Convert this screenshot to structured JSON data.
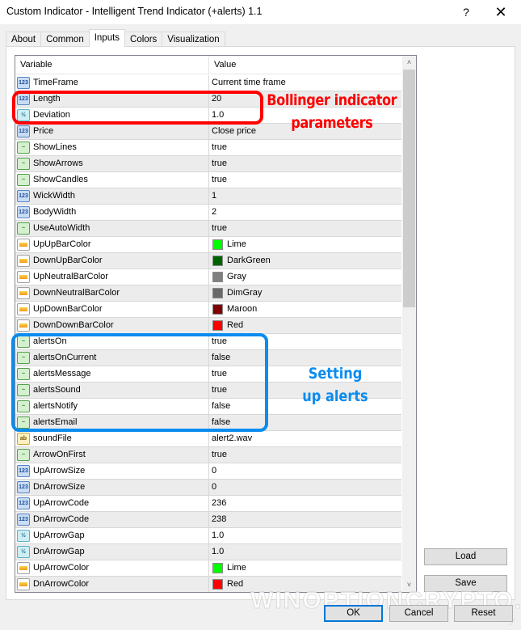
{
  "window": {
    "title": "Custom Indicator - Intelligent Trend Indicator (+alerts) 1.1",
    "help_label": "?",
    "close_label": "✕"
  },
  "tabs": [
    {
      "label": "About",
      "active": false
    },
    {
      "label": "Common",
      "active": false
    },
    {
      "label": "Inputs",
      "active": true
    },
    {
      "label": "Colors",
      "active": false
    },
    {
      "label": "Visualization",
      "active": false
    }
  ],
  "grid": {
    "columns": {
      "variable": "Variable",
      "value": "Value"
    },
    "rows": [
      {
        "type": "int",
        "name": "TimeFrame",
        "value": "Current time frame"
      },
      {
        "type": "int",
        "name": "Length",
        "value": "20"
      },
      {
        "type": "double",
        "name": "Deviation",
        "value": "1.0"
      },
      {
        "type": "int",
        "name": "Price",
        "value": "Close price"
      },
      {
        "type": "bool",
        "name": "ShowLines",
        "value": "true"
      },
      {
        "type": "bool",
        "name": "ShowArrows",
        "value": "true"
      },
      {
        "type": "bool",
        "name": "ShowCandles",
        "value": "true"
      },
      {
        "type": "int",
        "name": "WickWidth",
        "value": "1"
      },
      {
        "type": "int",
        "name": "BodyWidth",
        "value": "2"
      },
      {
        "type": "bool",
        "name": "UseAutoWidth",
        "value": "true"
      },
      {
        "type": "color",
        "name": "UpUpBarColor",
        "value": "Lime",
        "swatch": "#00ff00"
      },
      {
        "type": "color",
        "name": "DownUpBarColor",
        "value": "DarkGreen",
        "swatch": "#006400"
      },
      {
        "type": "color",
        "name": "UpNeutralBarColor",
        "value": "Gray",
        "swatch": "#808080"
      },
      {
        "type": "color",
        "name": "DownNeutralBarColor",
        "value": "DimGray",
        "swatch": "#696969"
      },
      {
        "type": "color",
        "name": "UpDownBarColor",
        "value": "Maroon",
        "swatch": "#800000"
      },
      {
        "type": "color",
        "name": "DownDownBarColor",
        "value": "Red",
        "swatch": "#ff0000"
      },
      {
        "type": "bool",
        "name": "alertsOn",
        "value": "true"
      },
      {
        "type": "bool",
        "name": "alertsOnCurrent",
        "value": "false"
      },
      {
        "type": "bool",
        "name": "alertsMessage",
        "value": "true"
      },
      {
        "type": "bool",
        "name": "alertsSound",
        "value": "true"
      },
      {
        "type": "bool",
        "name": "alertsNotify",
        "value": "false"
      },
      {
        "type": "bool",
        "name": "alertsEmail",
        "value": "false"
      },
      {
        "type": "string",
        "name": "soundFile",
        "value": "alert2.wav"
      },
      {
        "type": "bool",
        "name": "ArrowOnFirst",
        "value": "true"
      },
      {
        "type": "int",
        "name": "UpArrowSize",
        "value": "0"
      },
      {
        "type": "int",
        "name": "DnArrowSize",
        "value": "0"
      },
      {
        "type": "int",
        "name": "UpArrowCode",
        "value": "236"
      },
      {
        "type": "int",
        "name": "DnArrowCode",
        "value": "238"
      },
      {
        "type": "double",
        "name": "UpArrowGap",
        "value": "1.0"
      },
      {
        "type": "double",
        "name": "DnArrowGap",
        "value": "1.0"
      },
      {
        "type": "color",
        "name": "UpArrowColor",
        "value": "Lime",
        "swatch": "#00ff00"
      },
      {
        "type": "color",
        "name": "DnArrowColor",
        "value": "Red",
        "swatch": "#ff0000"
      }
    ]
  },
  "icons": {
    "int": "123",
    "double": "½",
    "bool": "~",
    "color": "",
    "string": "ab"
  },
  "scrollbar": {
    "up": "˄",
    "down": "˅"
  },
  "buttons": {
    "load": "Load",
    "save": "Save",
    "ok": "OK",
    "cancel": "Cancel",
    "reset": "Reset"
  },
  "annotations": {
    "bollinger": "Bollinger indicator parameters",
    "alerts": "Setting up alerts"
  },
  "watermark": "WINOPTIONCRYPTO.COM",
  "colors": {
    "annotation_red": "#ff0000",
    "annotation_blue": "#0a8cf0",
    "default_button_border": "#0078d7"
  }
}
